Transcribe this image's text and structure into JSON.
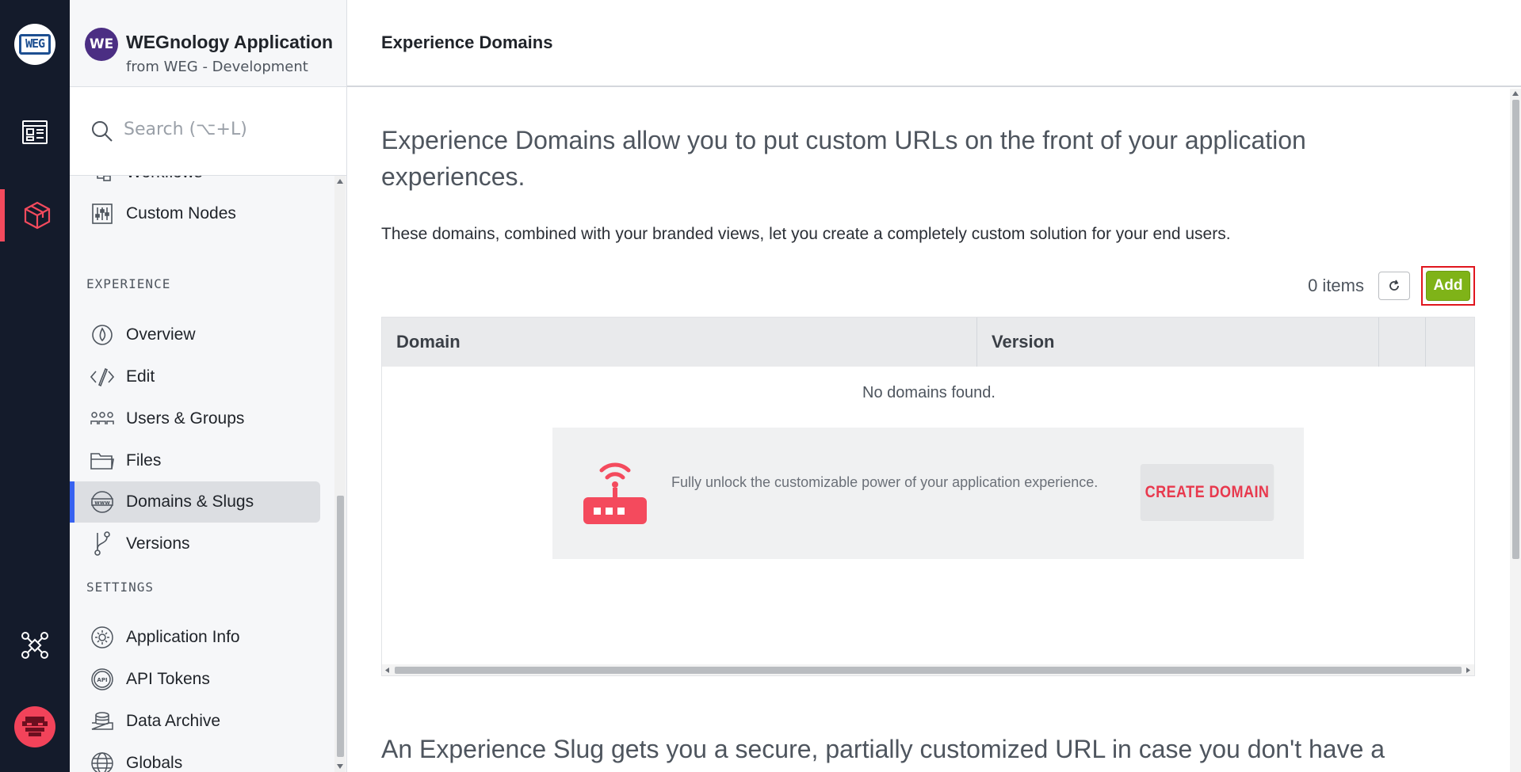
{
  "rail": {
    "logo_text": "WEG",
    "items": [
      "dashboards",
      "applications",
      "integrations"
    ],
    "accent": "#f44a5d"
  },
  "app": {
    "initials": "WE",
    "name": "WEGnology Application",
    "subtitle": "from WEG - Development"
  },
  "search": {
    "placeholder": "Search (⌥+L)"
  },
  "nav": {
    "partial_item": "Workflows",
    "custom_nodes": "Custom Nodes",
    "experience_header": "EXPERIENCE",
    "experience_items": [
      "Overview",
      "Edit",
      "Users & Groups",
      "Files",
      "Domains & Slugs",
      "Versions"
    ],
    "settings_header": "SETTINGS",
    "settings_items": [
      "Application Info",
      "API Tokens",
      "Data Archive",
      "Globals"
    ],
    "active": "Domains & Slugs"
  },
  "page": {
    "title": "Experience Domains",
    "lead": "Experience Domains allow you to put custom URLs on the front of your application experiences.",
    "description": "These domains, combined with your branded views, let you create a completely custom solution for your end users.",
    "count": "0 items",
    "add_label": "Add",
    "table": {
      "columns": [
        "Domain",
        "Version"
      ],
      "empty": "No domains found."
    },
    "promo": {
      "text": "Fully unlock the customizable power of your application experience.",
      "button": "CREATE DOMAIN"
    },
    "slug_text": "An Experience Slug gets you a secure, partially customized URL in case you don't have a"
  },
  "colors": {
    "primary_green": "#7fb318",
    "danger_red": "#e8394e",
    "active_blue": "#3862f0",
    "rail_bg": "#141b2b"
  }
}
